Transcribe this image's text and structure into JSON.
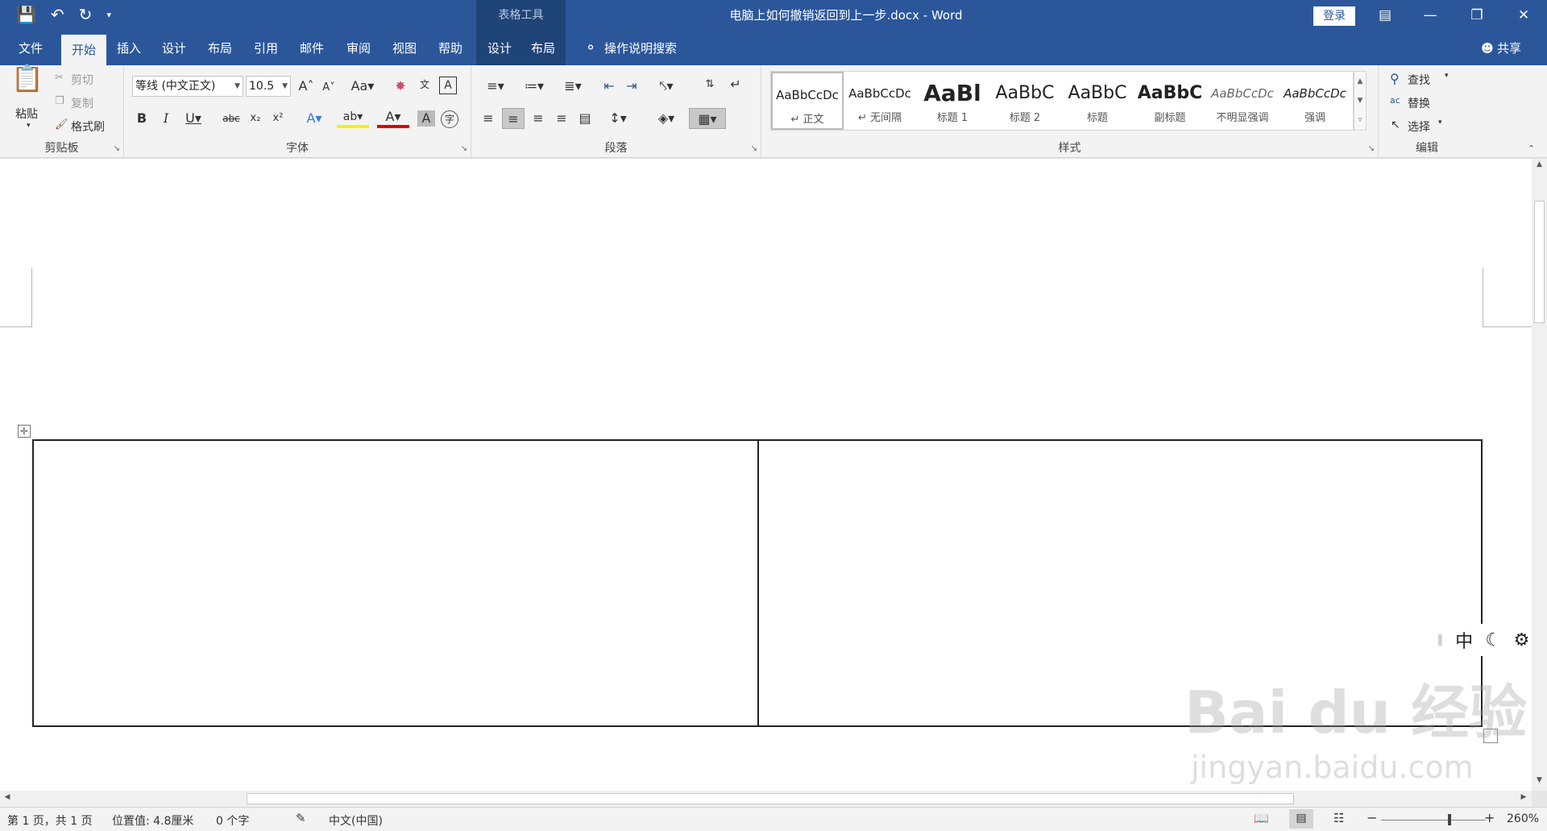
{
  "window": {
    "title": "电脑上如何撤销返回到上一步.docx  -  Word",
    "context_group": "表格工具",
    "login_label": "登录",
    "share_label": "共享",
    "search_label": "操作说明搜索"
  },
  "tabs": [
    {
      "label": "文件",
      "active": false
    },
    {
      "label": "开始",
      "active": true
    },
    {
      "label": "插入",
      "active": false
    },
    {
      "label": "设计",
      "active": false
    },
    {
      "label": "布局",
      "active": false
    },
    {
      "label": "引用",
      "active": false
    },
    {
      "label": "邮件",
      "active": false
    },
    {
      "label": "审阅",
      "active": false
    },
    {
      "label": "视图",
      "active": false
    },
    {
      "label": "帮助",
      "active": false
    }
  ],
  "context_tabs": [
    {
      "label": "设计"
    },
    {
      "label": "布局"
    }
  ],
  "clipboard": {
    "label": "剪贴板",
    "paste": "粘贴",
    "cut": "剪切",
    "copy": "复制",
    "format_painter": "格式刷"
  },
  "font": {
    "label": "字体",
    "name": "等线 (中文正文)",
    "size": "10.5"
  },
  "paragraph": {
    "label": "段落"
  },
  "styles": {
    "label": "样式",
    "items": [
      {
        "preview": "AaBbCcDc",
        "name": "↵ 正文",
        "selected": true
      },
      {
        "preview": "AaBbCcDc",
        "name": "↵ 无间隔",
        "selected": false
      },
      {
        "preview": "AaBl",
        "name": "标题 1",
        "selected": false
      },
      {
        "preview": "AaBbC",
        "name": "标题 2",
        "selected": false
      },
      {
        "preview": "AaBbC",
        "name": "标题",
        "selected": false
      },
      {
        "preview": "AaBbC",
        "name": "副标题",
        "selected": false
      },
      {
        "preview": "AaBbCcDc",
        "name": "不明显强调",
        "selected": false
      },
      {
        "preview": "AaBbCcDc",
        "name": "强调",
        "selected": false
      }
    ]
  },
  "editing": {
    "label": "编辑",
    "find": "查找",
    "replace": "替换",
    "select": "选择"
  },
  "status": {
    "page": "第 1 页，共 1 页",
    "position": "位置值: 4.8厘米",
    "words": "0 个字",
    "language": "中文(中国)",
    "zoom": "260%"
  },
  "ime": {
    "mode": "中"
  },
  "watermark": {
    "brand": "Bai du 经验",
    "url": "jingyan.baidu.com"
  }
}
